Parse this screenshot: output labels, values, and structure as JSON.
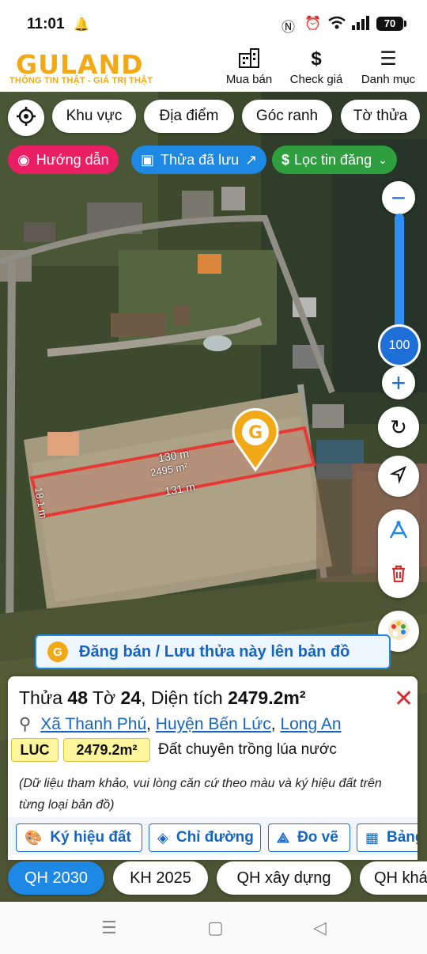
{
  "status": {
    "time": "11:01",
    "battery": "70"
  },
  "header": {
    "logo": "GULAND",
    "slogan": "THÔNG TIN THẬT - GIÁ TRỊ THẬT",
    "nav": [
      {
        "label": "Mua bán",
        "icon": "building-icon"
      },
      {
        "label": "Check giá",
        "icon": "dollar-icon"
      },
      {
        "label": "Danh mục",
        "icon": "menu-icon"
      }
    ]
  },
  "filters": {
    "chips": [
      "Khu vực",
      "Địa điểm",
      "Góc ranh",
      "Tờ thửa"
    ],
    "guide": "Hướng dẫn",
    "saved": "Thửa đã lưu",
    "filter": "Lọc tin đăng"
  },
  "map": {
    "zoom": "100",
    "dim_top": "130 m",
    "area": "2495 m²",
    "dim_bottom": "131 m",
    "dim_left": "18.1 m"
  },
  "save_banner": "Đăng bán / Lưu thửa này lên bản đồ",
  "card": {
    "thua_label": "Thửa",
    "thua": "48",
    "to_label": "Tờ",
    "to": "24",
    "area_label": "Diện tích",
    "area": "2479.2m²",
    "ward": "Xã Thanh Phú",
    "district": "Huyện Bến Lức",
    "province": "Long An",
    "land_code": "LUC",
    "land_area": "2479.2m²",
    "land_type": "Đất chuyên trồng lúa nước",
    "note": "(Dữ liệu tham khảo, vui lòng căn cứ theo màu và ký hiệu đất trên từng loại bản đồ)",
    "actions": [
      "Ký hiệu đất",
      "Chỉ đường",
      "Đo vẽ",
      "Bảng"
    ]
  },
  "tabs": [
    "QH 2030",
    "KH 2025",
    "QH xây dựng",
    "QH khác"
  ],
  "colors": {
    "brand": "#f2a917",
    "accent": "#1e88e5",
    "parcel": "#e53935"
  }
}
